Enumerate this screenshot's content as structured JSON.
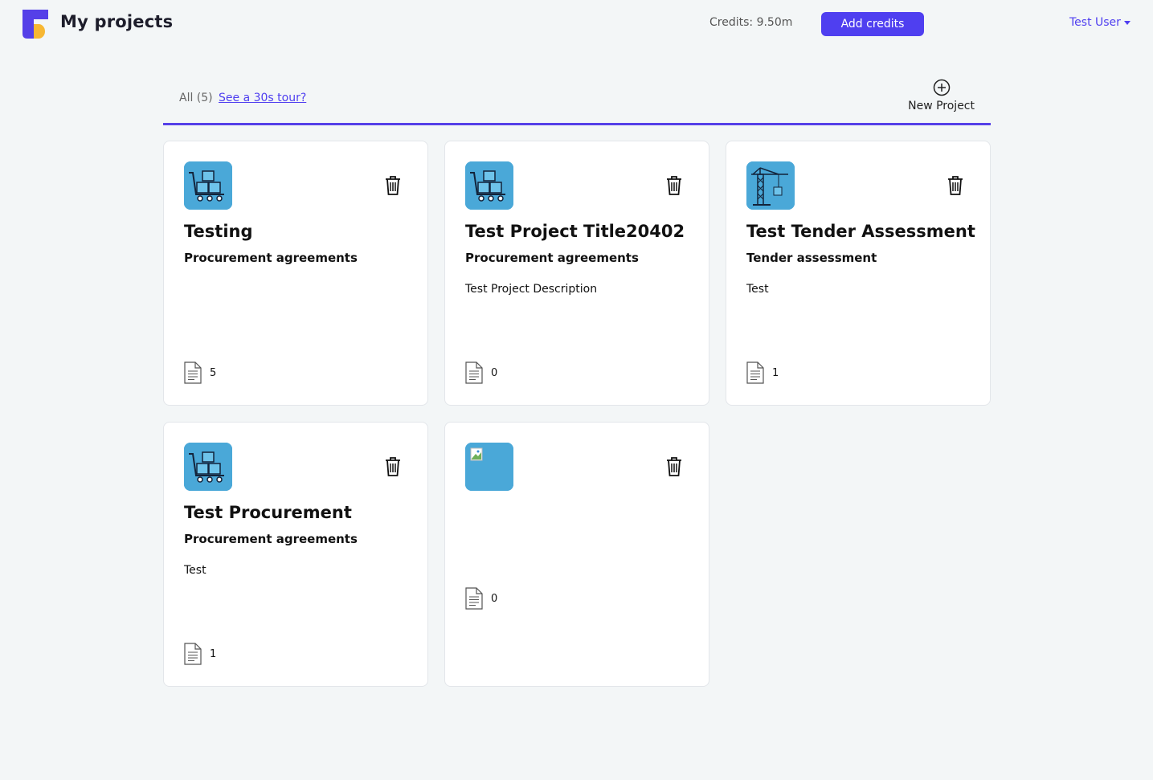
{
  "header": {
    "title": "My projects",
    "credits": "Credits: 9.50m",
    "add_credits_label": "Add credits",
    "user_name": "Test User"
  },
  "tabs": {
    "all_label": "All (5)",
    "tour_link": "See a 30s tour?",
    "new_project_label": "New Project"
  },
  "colors": {
    "accent": "#4f3ff0",
    "thumb_bg": "#4aa8d8",
    "logo_blue": "#5540e8",
    "logo_yellow": "#f7b733"
  },
  "projects": [
    {
      "title": "Testing",
      "category": "Procurement agreements",
      "description": "",
      "doc_count": "5",
      "icon": "cart-icon"
    },
    {
      "title": "Test Project Title20402",
      "category": "Procurement agreements",
      "description": "Test Project Description",
      "doc_count": "0",
      "icon": "cart-icon"
    },
    {
      "title": "Test Tender Assessment",
      "category": "Tender assessment",
      "description": "Test",
      "doc_count": "1",
      "icon": "crane-icon"
    },
    {
      "title": "Test Procurement",
      "category": "Procurement agreements",
      "description": "Test",
      "doc_count": "1",
      "icon": "cart-icon"
    },
    {
      "title": "",
      "category": "",
      "description": "",
      "doc_count": "0",
      "icon": "broken-image-icon"
    }
  ]
}
